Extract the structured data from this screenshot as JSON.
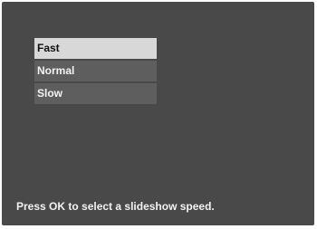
{
  "menu": {
    "items": [
      {
        "label": "Fast",
        "selected": true
      },
      {
        "label": "Normal",
        "selected": false
      },
      {
        "label": "Slow",
        "selected": false
      }
    ]
  },
  "footer": {
    "hint": "Press OK to select a slideshow speed."
  },
  "colors": {
    "screen_background": "#494949",
    "item_background": "#5e5e5e",
    "selected_background": "#d8d8d8",
    "text": "#f2f2f2",
    "selected_text": "#111111"
  }
}
